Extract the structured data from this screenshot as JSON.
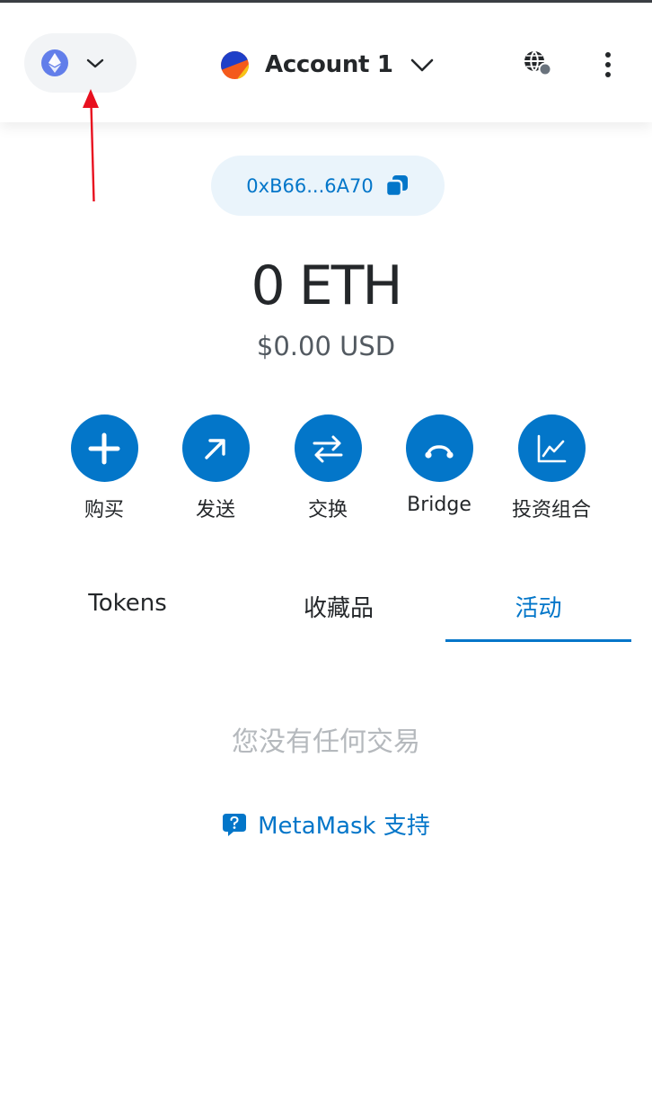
{
  "header": {
    "network": {
      "icon": "ethereum-icon",
      "chevron": "chevron-down-icon"
    },
    "account": {
      "name": "Account 1",
      "avatar": "account-avatar",
      "chevron": "chevron-down-icon"
    },
    "connections_icon": "globe-icon",
    "menu_icon": "kebab-menu-icon"
  },
  "address": {
    "short": "0xB66...6A70",
    "copy_icon": "copy-icon"
  },
  "balance": {
    "primary": "0 ETH",
    "fiat": "$0.00 USD"
  },
  "actions": [
    {
      "label": "购买",
      "icon": "plus-icon"
    },
    {
      "label": "发送",
      "icon": "arrow-up-right-icon"
    },
    {
      "label": "交换",
      "icon": "swap-arrows-icon"
    },
    {
      "label": "Bridge",
      "icon": "bridge-icon"
    },
    {
      "label": "投资组合",
      "icon": "chart-icon"
    }
  ],
  "tabs": [
    {
      "label": "Tokens",
      "active": false
    },
    {
      "label": "收藏品",
      "active": false
    },
    {
      "label": "活动",
      "active": true
    }
  ],
  "activity": {
    "empty_message": "您没有任何交易",
    "support_label": "MetaMask 支持",
    "support_icon": "question-chat-icon"
  },
  "colors": {
    "accent": "#0376c9",
    "ethereum": "#627eea",
    "annotation": "#e8101f",
    "muted_text": "#b5b9bd",
    "pill_background": "#eaf4fb"
  }
}
